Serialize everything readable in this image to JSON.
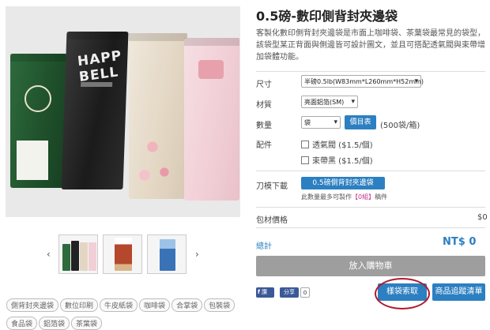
{
  "product": {
    "title": "0.5磅-數印側背封夾邊袋",
    "description": "客製化數印側背封夾邊袋是市面上咖啡袋、茶葉袋最常見的袋型，該袋型某正背面與側邊皆可設計圖文，並且可搭配透氣閥與束帶增加袋體功能。"
  },
  "hero": {
    "black_bag_text": "HAPP BELL"
  },
  "gallery": {
    "prev": "‹",
    "next": "›"
  },
  "form": {
    "size_label": "尺寸",
    "size_value": "半磅0.5lb(W83mm*L260mm*H52mm)",
    "material_label": "材質",
    "material_value": "亮面鋁箔(SM)",
    "qty_label": "數量",
    "qty_value": "袋",
    "price_table_button": "價目表",
    "qty_unit": "(500袋/箱)",
    "accessory_label": "配件",
    "options": [
      "透氣閥 ($1.5/個)",
      "束帶黑 ($1.5/個)"
    ],
    "knife_label": "刀模下載",
    "knife_button": "0.5磅側背封夾邊袋",
    "note_before": "此數量最多可製作",
    "note_highlight": "【0組】",
    "note_after": "稿件"
  },
  "totals": {
    "material_price_label": "包材價格",
    "material_price": "$0",
    "total_label": "總計",
    "total_value": "NT$ 0"
  },
  "actions": {
    "add_to_cart": "放入購物車",
    "fb_label": "讚",
    "share_label": "分享",
    "share_count": "0",
    "sample_request": "樣袋索取",
    "wishlist": "商品追蹤清單"
  },
  "tags": [
    "側背封夾邊袋",
    "數位印刷",
    "牛皮紙袋",
    "咖啡袋",
    "合掌袋",
    "包裝袋",
    "食品袋",
    "鋁箔袋",
    "茶葉袋"
  ],
  "colors": {
    "accent": "#2c7fc1",
    "highlight": "#c0328a",
    "annotation": "#b2182b"
  }
}
